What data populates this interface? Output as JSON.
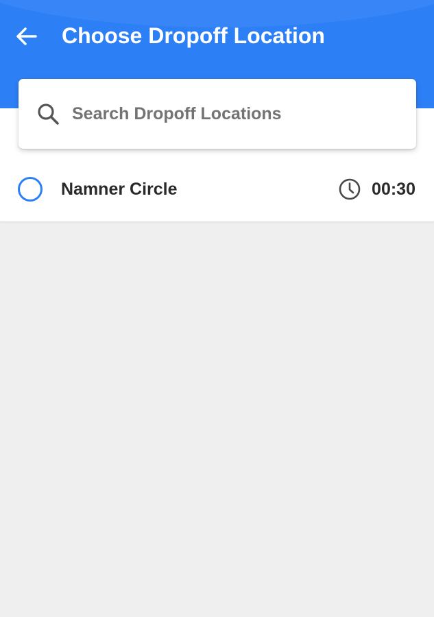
{
  "header": {
    "title": "Choose Dropoff Location",
    "back_icon": "arrow-left-icon",
    "background_color": "#2d7ff6"
  },
  "search": {
    "placeholder": "Search Dropoff Locations",
    "value": "",
    "icon": "search-icon"
  },
  "locations": [
    {
      "name": "Namner Circle",
      "time": "00:30",
      "selected": false,
      "icon": "clock-icon"
    }
  ],
  "colors": {
    "accent": "#2d7ff6",
    "background": "#efefef",
    "text": "#2a2a2a",
    "placeholder": "#737373"
  }
}
